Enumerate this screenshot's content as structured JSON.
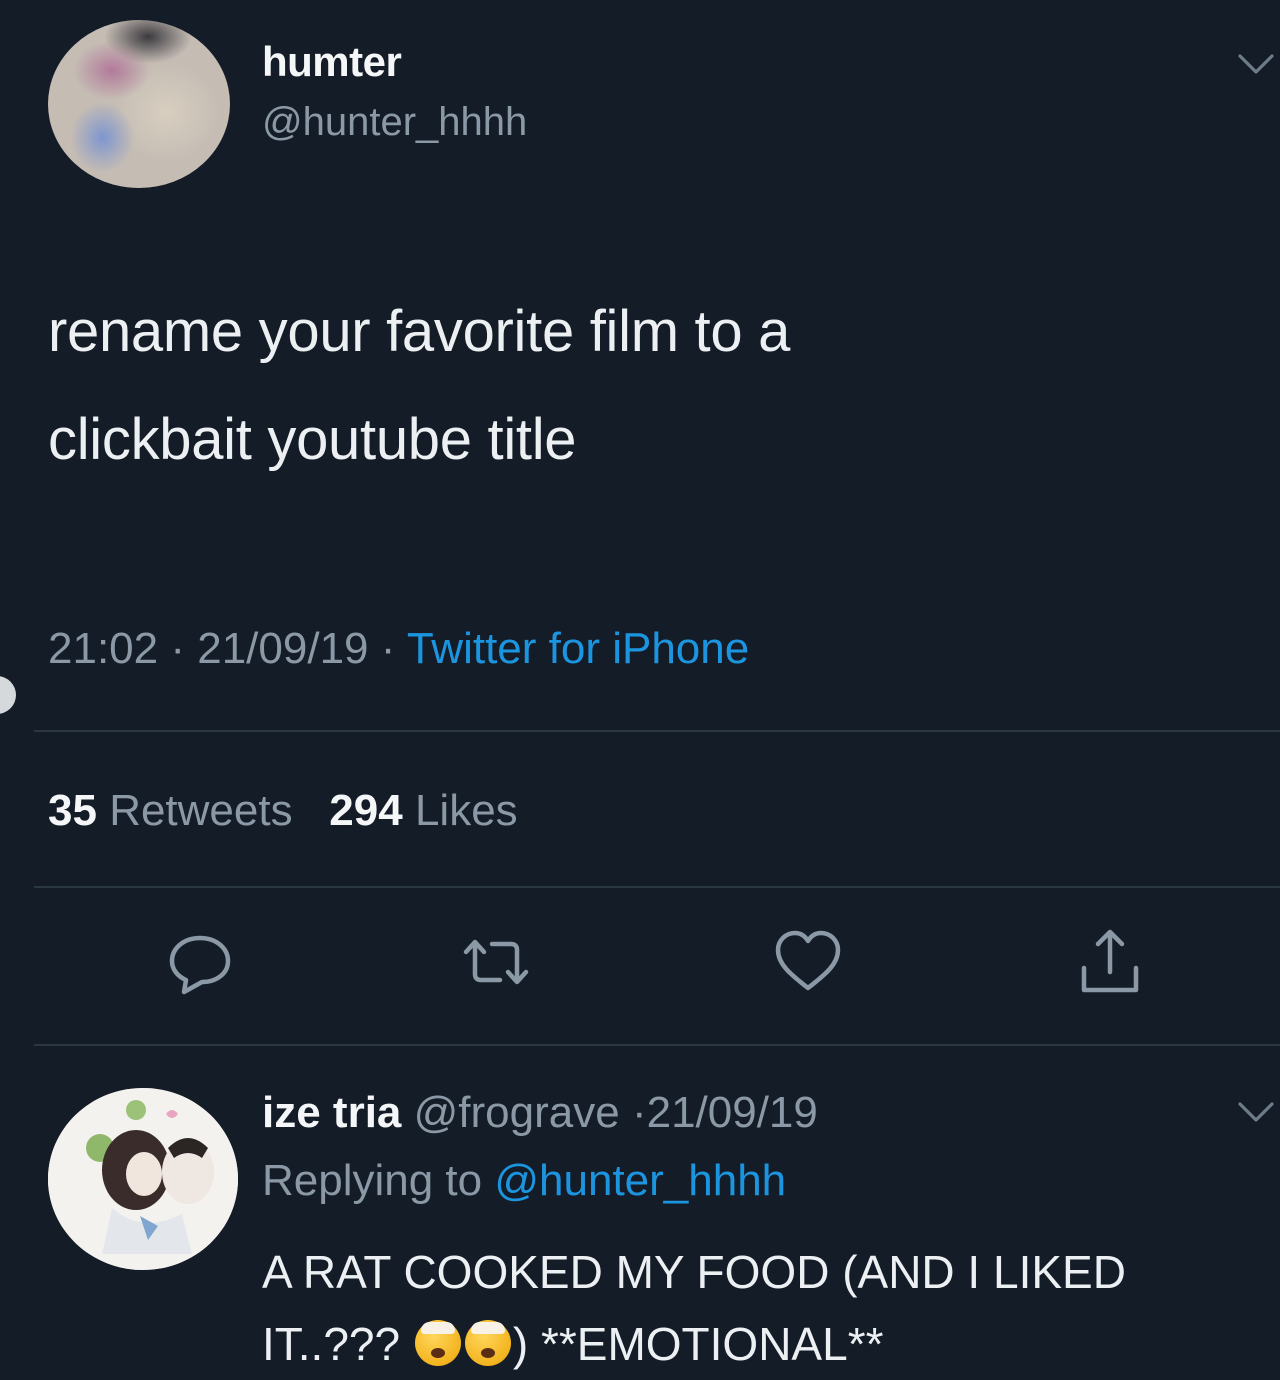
{
  "tweet": {
    "display_name": "humter",
    "handle": "@hunter_hhhh",
    "text_line1": "rename your favorite film to a",
    "text_line2": "clickbait youtube title",
    "time": "21:02",
    "date": "21/09/19",
    "source": "Twitter for iPhone",
    "retweets_count": "35",
    "retweets_label": "Retweets",
    "likes_count": "294",
    "likes_label": "Likes"
  },
  "actions": {
    "reply_icon": "speech-bubble-icon",
    "retweet_icon": "retweet-icon",
    "like_icon": "heart-icon",
    "share_icon": "share-icon"
  },
  "reply": {
    "display_name": "ize tria",
    "handle": "@frograve",
    "date": "21/09/19",
    "replying_prefix": "Replying to",
    "replying_to": "@hunter_hhhh",
    "text_part1": "A RAT COOKED MY FOOD (AND I LIKED IT..???",
    "text_part2": ") **EMOTIONAL**",
    "emoji_name": "exploding-head-emoji"
  },
  "colors": {
    "background": "#141c27",
    "text_primary": "#f4f6f8",
    "text_secondary": "#8b98a5",
    "link": "#1c95e0",
    "divider": "#2b3743"
  }
}
